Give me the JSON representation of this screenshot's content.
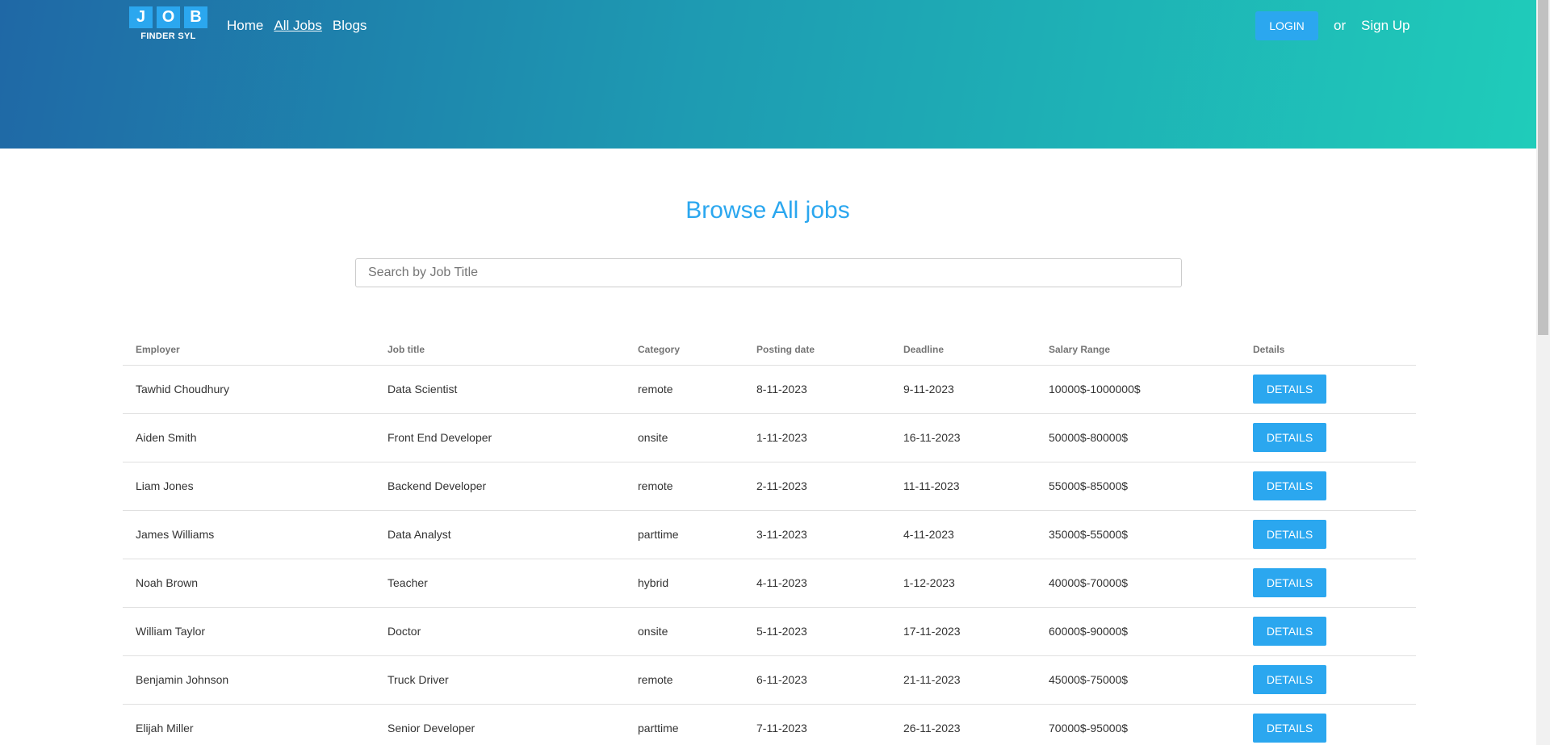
{
  "logo": {
    "letters": [
      "J",
      "O",
      "B"
    ],
    "subtitle": "FINDER SYL"
  },
  "nav": {
    "home": "Home",
    "all_jobs": "All Jobs",
    "blogs": "Blogs"
  },
  "auth": {
    "login": "LOGIN",
    "or": "or",
    "signup": "Sign Up"
  },
  "main": {
    "title": "Browse All jobs",
    "search_placeholder": "Search by Job Title"
  },
  "table": {
    "headers": [
      "Employer",
      "Job title",
      "Category",
      "Posting date",
      "Deadline",
      "Salary Range",
      "Details"
    ],
    "details_label": "DETAILS",
    "rows": [
      [
        "Tawhid Choudhury",
        "Data Scientist",
        "remote",
        "8-11-2023",
        "9-11-2023",
        "10000$-1000000$"
      ],
      [
        "Aiden Smith",
        "Front End Developer",
        "onsite",
        "1-11-2023",
        "16-11-2023",
        "50000$-80000$"
      ],
      [
        "Liam Jones",
        "Backend Developer",
        "remote",
        "2-11-2023",
        "11-11-2023",
        "55000$-85000$"
      ],
      [
        "James Williams",
        "Data Analyst",
        "parttime",
        "3-11-2023",
        "4-11-2023",
        "35000$-55000$"
      ],
      [
        "Noah Brown",
        "Teacher",
        "hybrid",
        "4-11-2023",
        "1-12-2023",
        "40000$-70000$"
      ],
      [
        "William Taylor",
        "Doctor",
        "onsite",
        "5-11-2023",
        "17-11-2023",
        "60000$-90000$"
      ],
      [
        "Benjamin Johnson",
        "Truck Driver",
        "remote",
        "6-11-2023",
        "21-11-2023",
        "45000$-75000$"
      ],
      [
        "Elijah Miller",
        "Senior Developer",
        "parttime",
        "7-11-2023",
        "26-11-2023",
        "70000$-95000$"
      ]
    ]
  },
  "colors": {
    "accent": "#2ba7ef",
    "hero_start": "#1f68a6",
    "hero_end": "#1fcdba"
  }
}
